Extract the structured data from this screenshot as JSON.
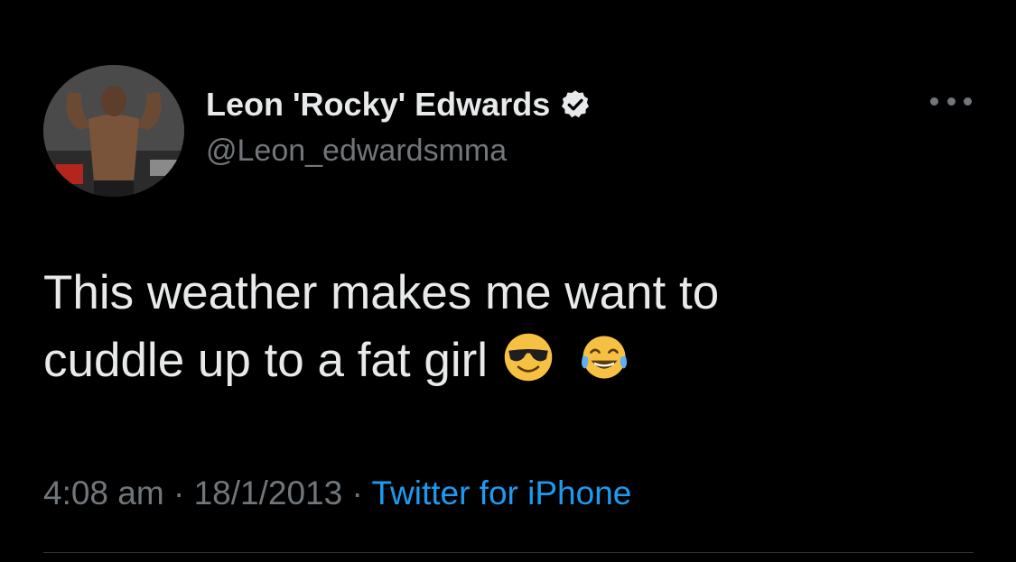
{
  "author": {
    "display_name": "Leon 'Rocky' Edwards",
    "handle": "@Leon_edwardsmma",
    "verified": true,
    "avatar_icon": "profile-photo"
  },
  "tweet": {
    "text_line1": "This weather makes me want to",
    "text_line2": "cuddle up to a fat girl",
    "emojis": [
      "smiling-face-with-sunglasses",
      "face-with-tears-of-joy"
    ]
  },
  "meta": {
    "time": "4:08 am",
    "separator": "·",
    "date": "18/1/2013",
    "source": "Twitter for iPhone"
  },
  "colors": {
    "background": "#000000",
    "primary_text": "#e7e9ea",
    "secondary_text": "#71767b",
    "link": "#1d9bf0",
    "divider": "#2f3336"
  }
}
